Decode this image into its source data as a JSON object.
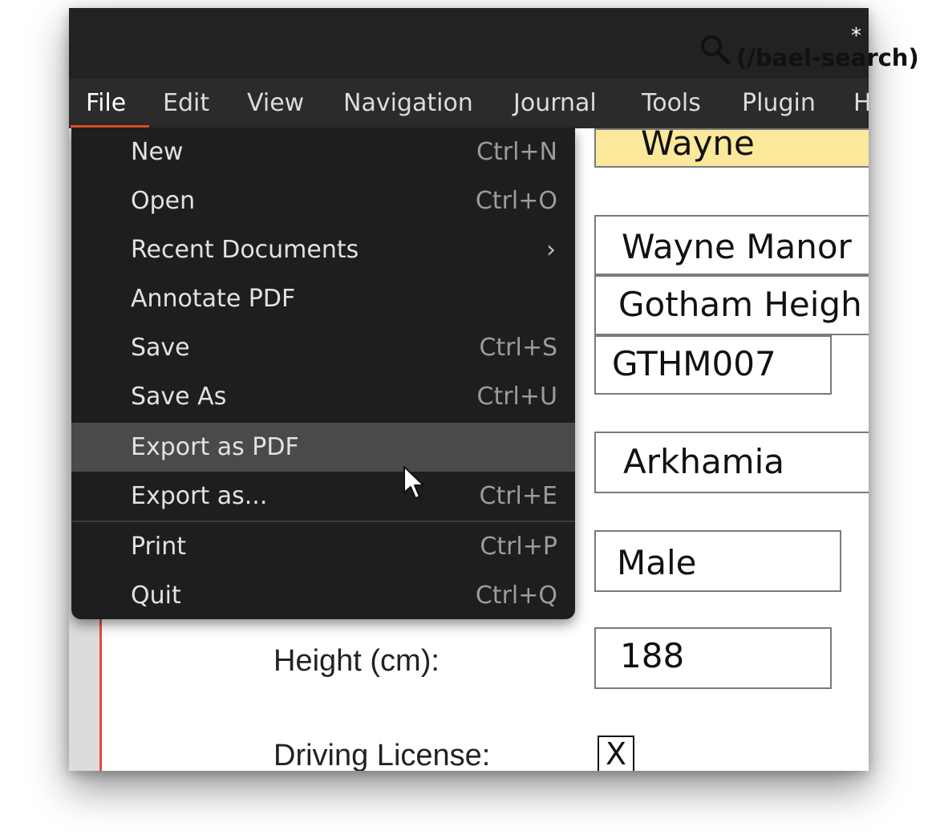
{
  "window": {
    "title_fragment": "*",
    "menubar": [
      "File",
      "Edit",
      "View",
      "Navigation",
      "Journal",
      "Tools",
      "Plugin",
      "H"
    ],
    "active_menu": "File"
  },
  "file_menu": {
    "items": [
      {
        "label": "New",
        "shortcut": "Ctrl+N"
      },
      {
        "label": "Open",
        "shortcut": "Ctrl+O"
      },
      {
        "label": "Recent Documents",
        "submenu": "›"
      },
      {
        "label": "Annotate PDF"
      },
      {
        "label": "Save",
        "shortcut": "Ctrl+S"
      },
      {
        "label": "Save As",
        "shortcut": "Ctrl+U"
      },
      {
        "label": "Export as PDF",
        "highlighted": true
      },
      {
        "label": "Export as...",
        "shortcut": "Ctrl+E"
      },
      {
        "label": "Print",
        "shortcut": "Ctrl+P"
      },
      {
        "label": "Quit",
        "shortcut": "Ctrl+Q"
      }
    ]
  },
  "form": {
    "fields": [
      "Wayne",
      "Wayne Manor",
      "Gotham Heigh",
      "GTHM007",
      "Arkhamia",
      "Male",
      "188"
    ],
    "labels": {
      "height": "Height (cm):",
      "driving_license": "Driving License:"
    },
    "driving_license_checkbox": "X"
  },
  "search_link": {
    "text": "(/bael-search)",
    "icon": "search-icon"
  },
  "colors": {
    "accent": "#e95420",
    "menu_bg": "#1e1e1e",
    "highlight": "#4a4a4a",
    "input_highlight": "#fce89a"
  }
}
